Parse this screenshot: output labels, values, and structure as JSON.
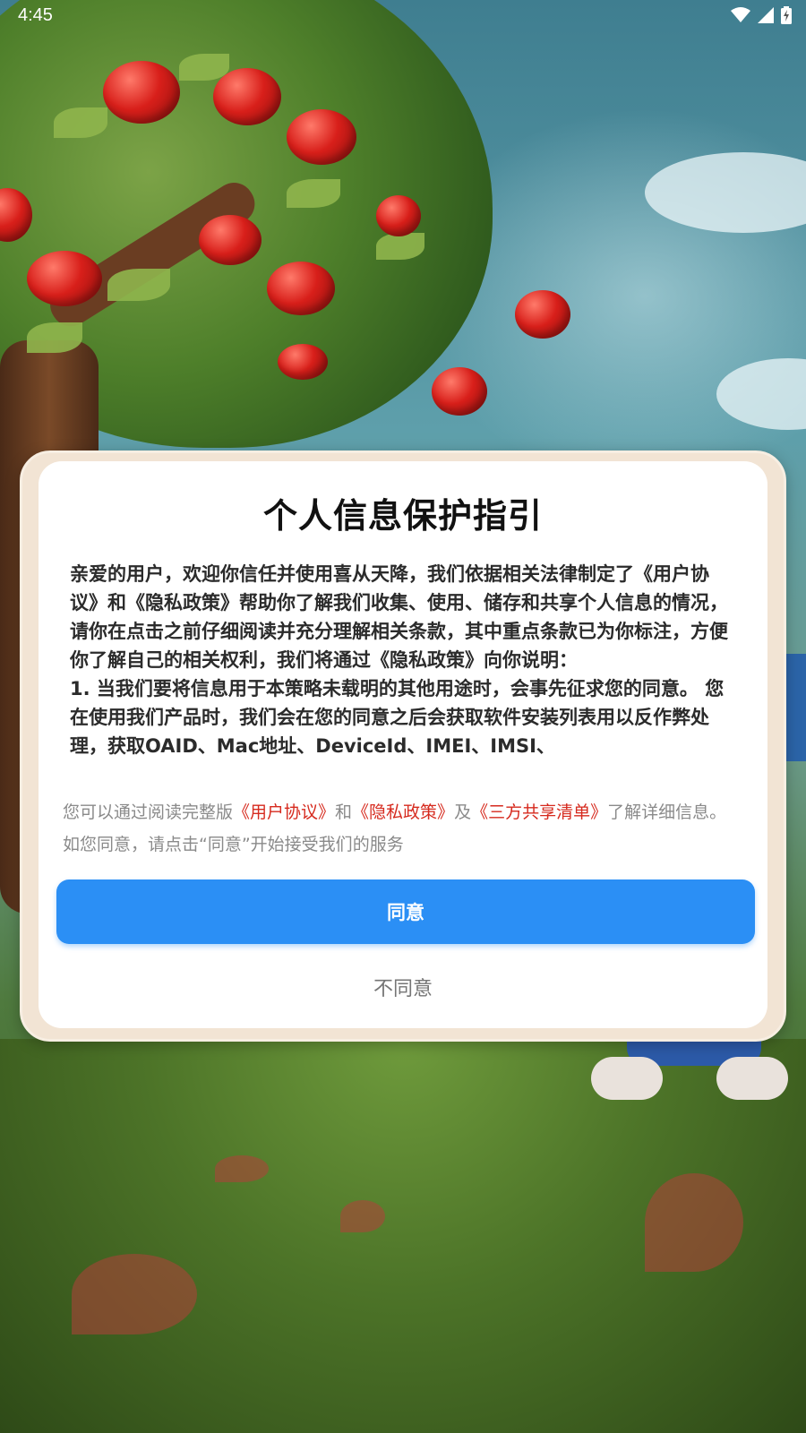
{
  "status_bar": {
    "time": "4:45",
    "icons": [
      "wifi-icon",
      "cellular-signal-icon",
      "battery-charging-icon"
    ]
  },
  "dialog": {
    "title": "个人信息保护指引",
    "policy_text": "亲爱的用户，欢迎你信任并使用喜从天降，我们依据相关法律制定了《用户协议》和《隐私政策》帮助你了解我们收集、使用、储存和共享个人信息的情况，请你在点击之前仔细阅读并充分理解相关条款，其中重点条款已为你标注，方便你了解自己的相关权利，我们将通过《隐私政策》向你说明：\n1. 当我们要将信息用于本策略未载明的其他用途时，会事先征求您的同意。 您在使用我们产品时，我们会在您的同意之后会获取软件安装列表用以反作弊处理，获取OAID、Mac地址、DeviceId、IMEI、IMSI、",
    "summary": {
      "prefix": "您可以通过阅读完整版",
      "link_user_agreement": "《用户协议》",
      "and": "和",
      "link_privacy_policy": "《隐私政策》",
      "and2": "及",
      "link_third_party_list": "《三方共享清单》",
      "suffix": "了解详细信息。如您同意，请点击“同意”开始接受我们的服务"
    },
    "agree_label": "同意",
    "disagree_label": "不同意"
  },
  "colors": {
    "accent": "#2b8ff5",
    "link": "#d62a1e",
    "frame": "#f2e4d4"
  }
}
